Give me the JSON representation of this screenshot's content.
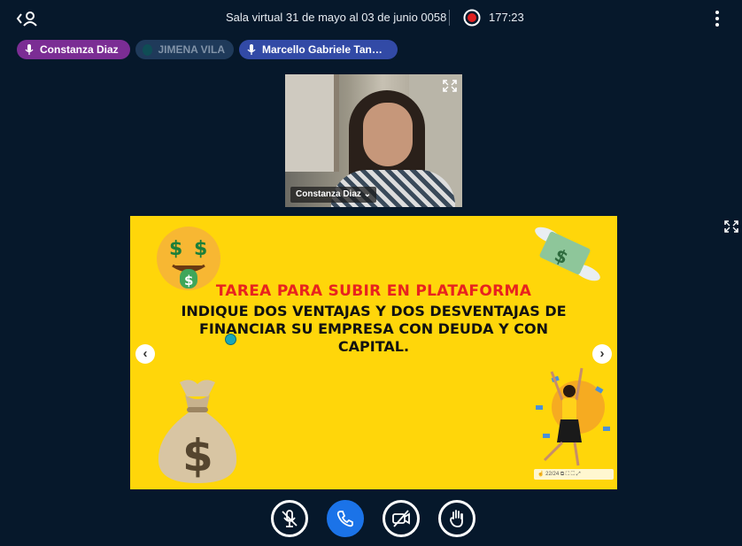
{
  "header": {
    "title": "Sala virtual 31 de mayo al 03 de junio 0058",
    "timer": "177:23"
  },
  "participants": [
    {
      "name": "Constanza Diaz",
      "mic": "mic-on",
      "color": "#7b2d94"
    },
    {
      "name": "JIMENA VILA",
      "mic": "none",
      "color": "#1f3a5a"
    },
    {
      "name": "Marcello Gabriele Tan…",
      "mic": "mic-on",
      "color": "#324aa6"
    }
  ],
  "webcam": {
    "label": "Constanza Diaz ⌄"
  },
  "slide": {
    "heading": "TAREA PARA SUBIR EN PLATAFORMA",
    "body": "INDIQUE DOS VENTAJAS Y DOS DESVENTAJAS DE FINANCIAR SU EMPRESA CON DEUDA Y CON CAPITAL.",
    "prev": "‹",
    "next": "›",
    "controls": "☝ 22/24 ⧉ ⛶ ⬚ ⤢"
  },
  "controls": [
    "mic-muted-icon",
    "phone-icon",
    "camera-off-icon",
    "raise-hand-icon"
  ],
  "colors": {
    "background": "#06182b",
    "slide": "#ffd60a",
    "accent": "#1b73e8",
    "record": "#e02020"
  }
}
